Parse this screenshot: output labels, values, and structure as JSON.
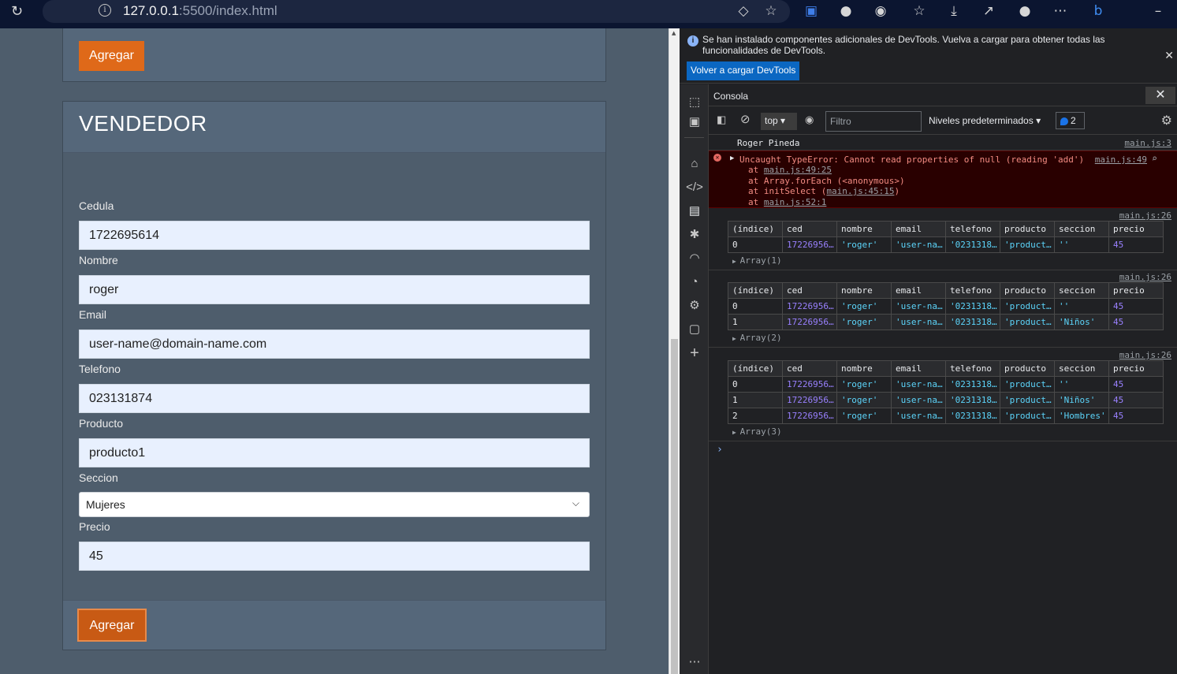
{
  "browser": {
    "url_host": "127.0.0.1",
    "url_path": ":5500/index.html"
  },
  "page": {
    "top_button_label": "Agregar",
    "card_title": "VENDEDOR",
    "fields": [
      {
        "label": "Cedula",
        "value": "1722695614"
      },
      {
        "label": "Nombre",
        "value": "roger"
      },
      {
        "label": "Email",
        "value": "user-name@domain-name.com"
      },
      {
        "label": "Telefono",
        "value": "023131874"
      },
      {
        "label": "Producto",
        "value": "producto1"
      }
    ],
    "seccion": {
      "label": "Seccion",
      "value": "Mujeres"
    },
    "precio": {
      "label": "Precio",
      "value": "45"
    },
    "submit_label": "Agregar"
  },
  "devtools": {
    "info_message": "Se han instalado componentes adicionales de DevTools. Vuelva a cargar para obtener todas las funcionalidades de DevTools.",
    "reload_button": "Volver a cargar DevTools",
    "panel_title": "Consola",
    "context": "top",
    "filter_placeholder": "Filtro",
    "levels": "Niveles predeterminados",
    "message_count": "2",
    "log_text": "Roger Pineda",
    "log_src": "main.js:3",
    "error": {
      "message": "Uncaught TypeError: Cannot read properties of null (reading 'add')",
      "src": "main.js:49",
      "stack": [
        {
          "prefix": "at ",
          "link": "main.js:49:25",
          "suffix": ""
        },
        {
          "prefix": "at Array.forEach (<anonymous>)",
          "link": "",
          "suffix": ""
        },
        {
          "prefix": "at initSelect (",
          "link": "main.js:45:15",
          "suffix": ")"
        },
        {
          "prefix": "at ",
          "link": "main.js:52:1",
          "suffix": ""
        }
      ]
    },
    "table_src": "main.js:26",
    "table_headers": [
      "(índice)",
      "ced",
      "nombre",
      "email",
      "telefono",
      "producto",
      "seccion",
      "precio"
    ],
    "tables": [
      {
        "array_label": "Array(1)",
        "rows": [
          [
            "0",
            "17226956…",
            "'roger'",
            "'user-na…",
            "'0231318…",
            "'product…",
            "''",
            "45"
          ]
        ]
      },
      {
        "array_label": "Array(2)",
        "rows": [
          [
            "0",
            "17226956…",
            "'roger'",
            "'user-na…",
            "'0231318…",
            "'product…",
            "''",
            "45"
          ],
          [
            "1",
            "17226956…",
            "'roger'",
            "'user-na…",
            "'0231318…",
            "'product…",
            "'Niños'",
            "45"
          ]
        ]
      },
      {
        "array_label": "Array(3)",
        "rows": [
          [
            "0",
            "17226956…",
            "'roger'",
            "'user-na…",
            "'0231318…",
            "'product…",
            "''",
            "45"
          ],
          [
            "1",
            "17226956…",
            "'roger'",
            "'user-na…",
            "'0231318…",
            "'product…",
            "'Niños'",
            "45"
          ],
          [
            "2",
            "17226956…",
            "'roger'",
            "'user-na…",
            "'0231318…",
            "'product…",
            "'Hombres'",
            "45"
          ]
        ]
      }
    ]
  }
}
